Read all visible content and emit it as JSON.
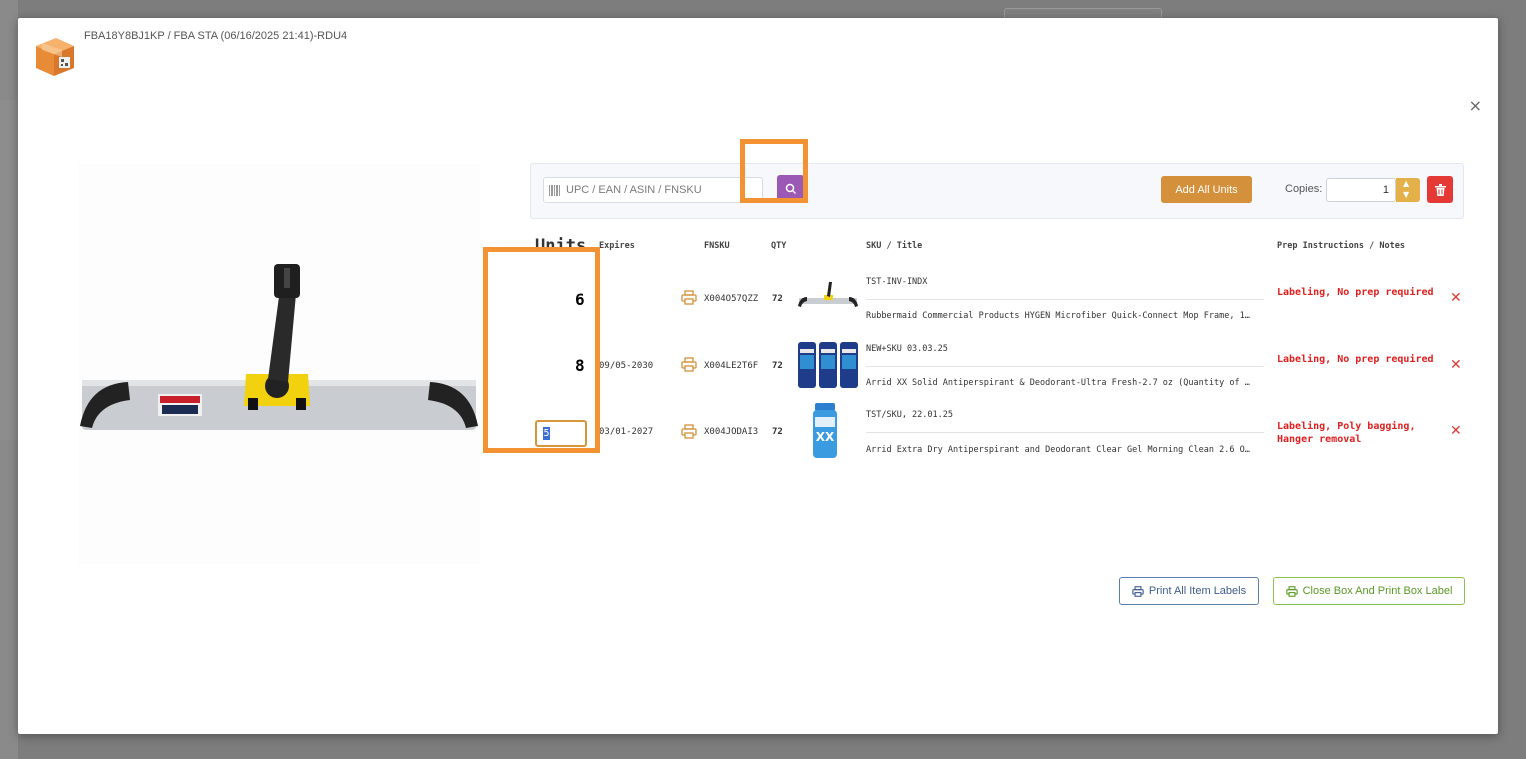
{
  "modal": {
    "title": "FBA18Y8BJ1KP / FBA STA (06/16/2025 21:41)-RDU4",
    "close_label": "×"
  },
  "toolbar": {
    "search_placeholder": "UPC / EAN / ASIN / FNSKU",
    "add_all_label": "Add All Units",
    "copies_label": "Copies:",
    "copies_value": "1"
  },
  "table": {
    "units_title": "Units",
    "headers": {
      "expires": "Expires",
      "fnsku": "FNSKU",
      "qty": "QTY",
      "sku_title": "SKU / Title",
      "prep": "Prep Instructions / Notes"
    },
    "rows": [
      {
        "units": "6",
        "expires": "",
        "fnsku": "X004O57QZZ",
        "qty": "72",
        "sku": "TST-INV-INDX",
        "title": "Rubbermaid Commercial Products HYGEN Microfiber Quick-Connect Mop Frame, 1…",
        "prep": "Labeling, No prep required",
        "remove": "✕"
      },
      {
        "units": "8",
        "expires": "09/05-2030",
        "fnsku": "X004LE2T6F",
        "qty": "72",
        "sku": "NEW+SKU 03.03.25",
        "title": "Arrid XX Solid Antiperspirant & Deodorant-Ultra Fresh-2.7 oz (Quantity of …",
        "prep": "Labeling, No prep required",
        "remove": "✕"
      },
      {
        "units": "5",
        "expires": "03/01-2027",
        "fnsku": "X004JODAI3",
        "qty": "72",
        "sku": "TST/SKU, 22.01.25",
        "title": "Arrid Extra Dry Antiperspirant and Deodorant Clear Gel Morning Clean 2.6 O…",
        "prep": "Labeling, Poly bagging, Hanger removal",
        "remove": "✕"
      }
    ]
  },
  "footer": {
    "print_all_label": "Print All Item Labels",
    "close_box_label": "Close Box And Print Box Label"
  },
  "icons": [
    "box-icon",
    "barcode-icon",
    "search-icon",
    "trash-icon",
    "printer-icon",
    "close-icon"
  ],
  "colors": {
    "search_button": "#9b59b6",
    "add_all_button": "#d4903a",
    "trash_button": "#e53935",
    "highlight": "#f39233",
    "prep_text": "#e02020"
  }
}
